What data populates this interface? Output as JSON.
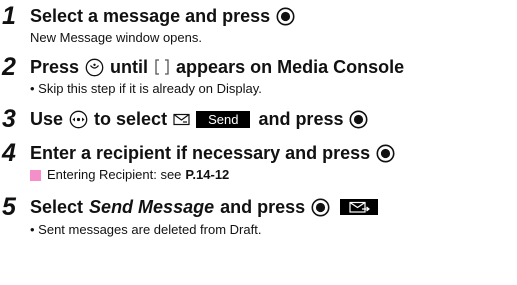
{
  "colors": {
    "text": "#111111",
    "highlight": "#f58fc9"
  },
  "steps": [
    {
      "number": "1",
      "title_a": "Select a message and press",
      "sub": "New Message window opens."
    },
    {
      "number": "2",
      "title_a": "Press",
      "title_b": "until",
      "title_c": "appears on Media Console",
      "sub": "• Skip this step if it is already on Display."
    },
    {
      "number": "3",
      "title_a": "Use",
      "title_b": "to select",
      "send_key": "Send",
      "title_c": "and press"
    },
    {
      "number": "4",
      "title_a": "Enter a recipient if necessary and press",
      "sub_a": "Entering Recipient: see",
      "sub_ref": "P.14-12"
    },
    {
      "number": "5",
      "title_a": "Select",
      "title_italic": "Send Message",
      "title_b": "and press",
      "sub": "• Sent messages are deleted from Draft."
    }
  ],
  "icons": {
    "center_key": "center-key-icon",
    "mic_key": "media-console-key-icon",
    "bracket": "display-area-icon",
    "side_key": "side-navigation-key-icon",
    "mail": "envelope-icon",
    "mail_send": "mail-send-key-icon"
  }
}
